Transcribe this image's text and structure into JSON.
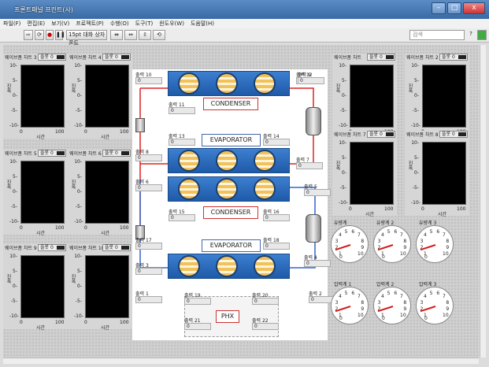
{
  "window": {
    "title": "프론트패널 프린트(사)",
    "min": "–",
    "max": "□",
    "close": "x"
  },
  "menu": [
    "파일(F)",
    "편집(E)",
    "보기(V)",
    "프로젝트(P)",
    "수행(O)",
    "도구(T)",
    "윈도우(W)",
    "도움말(H)"
  ],
  "toolbar": {
    "font": "15pt 대화 상자 폰트",
    "search_placeholder": "검색"
  },
  "charts": [
    {
      "title": "웨이브폼 차트 3",
      "legend": "플롯 0",
      "ylabel": "진폭",
      "xlabel": "시간",
      "yt": [
        "10-",
        "5-",
        "0-",
        "-5-",
        "-10-"
      ],
      "x0": "0",
      "x1": "100"
    },
    {
      "title": "웨이브폼 차트 4",
      "legend": "플롯 0",
      "ylabel": "진폭",
      "xlabel": "시간",
      "yt": [
        "10-",
        "5-",
        "0-",
        "-5-",
        "-10-"
      ],
      "x0": "0",
      "x1": "100"
    },
    {
      "title": "웨이브폼 차트 5",
      "legend": "플롯 0",
      "ylabel": "진폭",
      "xlabel": "시간",
      "yt": [
        "10-",
        "5-",
        "0-",
        "-5-",
        "-10-"
      ],
      "x0": "0",
      "x1": "100"
    },
    {
      "title": "웨이브폼 차트 6",
      "legend": "플롯 0",
      "ylabel": "진폭",
      "xlabel": "시간",
      "yt": [
        "10-",
        "5-",
        "0-",
        "-5-",
        "-10-"
      ],
      "x0": "0",
      "x1": "100"
    },
    {
      "title": "웨이브폼 차트 9",
      "legend": "플롯 0",
      "ylabel": "진폭",
      "xlabel": "시간",
      "yt": [
        "10-",
        "5-",
        "0-",
        "-5-",
        "-10-"
      ],
      "x0": "0",
      "x1": "100"
    },
    {
      "title": "웨이브폼 차트 10",
      "legend": "플롯 0",
      "ylabel": "진폭",
      "xlabel": "시간",
      "yt": [
        "10-",
        "5-",
        "0-",
        "-5-",
        "-10-"
      ],
      "x0": "0",
      "x1": "100"
    },
    {
      "title": "웨이브폼 차트",
      "legend": "플롯 0",
      "ylabel": "진폭",
      "xlabel": "시간",
      "yt": [
        "10-",
        "5-",
        "0-",
        "-5-",
        "-10-"
      ],
      "x0": "0",
      "x1": "100"
    },
    {
      "title": "웨이브폼 차트 2",
      "legend": "플롯 0",
      "ylabel": "진폭",
      "xlabel": "시간",
      "yt": [
        "10-",
        "5-",
        "0-",
        "-5-",
        "-10-"
      ],
      "x0": "0",
      "x1": "100"
    },
    {
      "title": "웨이브폼 차트 7",
      "legend": "플롯 0",
      "ylabel": "진폭",
      "xlabel": "시간",
      "yt": [
        "10-",
        "5-",
        "0-",
        "-5-",
        "-10-"
      ],
      "x0": "0",
      "x1": "100"
    },
    {
      "title": "웨이브폼 차트 8",
      "legend": "플롯 0",
      "ylabel": "진폭",
      "xlabel": "시간",
      "yt": [
        "10-",
        "5-",
        "0-",
        "-5-",
        "-10-"
      ],
      "x0": "0",
      "x1": "100"
    }
  ],
  "diagram": {
    "condenser1": "CONDENSER",
    "evaporator1": "EVAPORATOR",
    "condenser2": "CONDENSER",
    "evaporator2": "EVAPORATOR",
    "phx": "PHX"
  },
  "outputs": [
    {
      "label": "출력 10",
      "value": "0"
    },
    {
      "label": "출력 11",
      "value": "0"
    },
    {
      "label": "출력 12",
      "value": "0"
    },
    {
      "label": "출력 9",
      "value": "0"
    },
    {
      "label": "출력 13",
      "value": "0"
    },
    {
      "label": "출력 14",
      "value": "0"
    },
    {
      "label": "출력 8",
      "value": "0"
    },
    {
      "label": "출력 7",
      "value": "0"
    },
    {
      "label": "출력 6",
      "value": "0"
    },
    {
      "label": "출력 5",
      "value": "0"
    },
    {
      "label": "출력 15",
      "value": "0"
    },
    {
      "label": "출력 16",
      "value": "0"
    },
    {
      "label": "출력 17",
      "value": "0"
    },
    {
      "label": "출력 18",
      "value": "0"
    },
    {
      "label": "출력 3",
      "value": "0"
    },
    {
      "label": "출력 4",
      "value": "0"
    },
    {
      "label": "출력 1",
      "value": "0"
    },
    {
      "label": "출력 2",
      "value": "0"
    },
    {
      "label": "출력 19",
      "value": "0"
    },
    {
      "label": "출력 20",
      "value": "0"
    },
    {
      "label": "출력 21",
      "value": "0"
    },
    {
      "label": "출력 22",
      "value": "0"
    }
  ],
  "gauges": [
    {
      "title": "유량계",
      "value": 0.1
    },
    {
      "title": "유량계 2",
      "value": 0.1
    },
    {
      "title": "유량계 3",
      "value": 0.1
    },
    {
      "title": "압력계 1",
      "value": 0.1
    },
    {
      "title": "압력계 2",
      "value": 0.1
    },
    {
      "title": "압력계 3",
      "value": 0.1
    }
  ],
  "gauge_ticks": [
    "1",
    "2",
    "3",
    "4",
    "5",
    "6",
    "7",
    "8",
    "9",
    "10"
  ],
  "gauge_zero": "0"
}
